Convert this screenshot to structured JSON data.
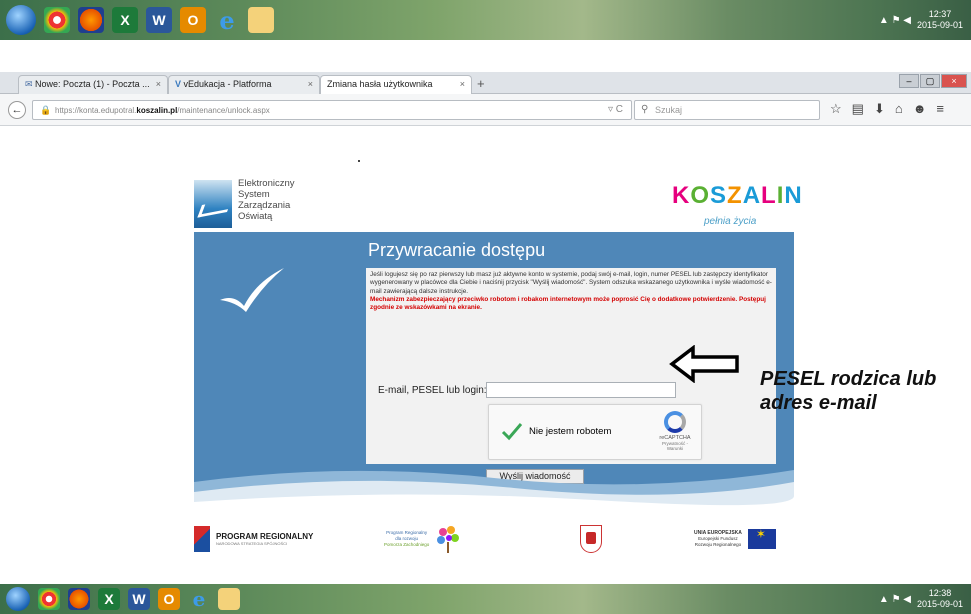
{
  "taskbar": {
    "apps": [
      {
        "icon": "windows-start-icon"
      },
      {
        "icon": "chrome-icon"
      },
      {
        "icon": "firefox-icon"
      },
      {
        "icon": "excel-icon",
        "glyph": "X"
      },
      {
        "icon": "word-icon",
        "glyph": "W"
      },
      {
        "icon": "outlook-icon",
        "glyph": "O"
      },
      {
        "icon": "ie-icon",
        "glyph": "e"
      },
      {
        "icon": "folder-icon"
      }
    ],
    "top_clock": {
      "time": "12:37",
      "date": "2015-09-01"
    },
    "bottom_clock": {
      "time": "12:38",
      "date": "2015-09-01"
    }
  },
  "browser": {
    "tabs": [
      {
        "label": "Nowe: Poczta (1) - Poczta ..."
      },
      {
        "label": "vEdukacja - Platforma"
      },
      {
        "label": "Zmiana hasła użytkownika"
      }
    ],
    "new_tab": "+",
    "url_prefix": "https://konta.edupotral.",
    "url_domain": "koszalin.pl",
    "url_path": "/maintenance/unlock.aspx",
    "search_placeholder": "Szukaj"
  },
  "page": {
    "esz_logo_lines": [
      "Elektroniczny",
      "System",
      "Zarządzania",
      "Oświatą"
    ],
    "koszalin_logo": {
      "word": "KOSZALIN",
      "tagline": "pełnia życia",
      "letter_colors": [
        "#e6007e",
        "#5ab033",
        "#1a9bd7",
        "#f39200",
        "#1a9bd7",
        "#e6007e",
        "#5ab033",
        "#1a9bd7"
      ]
    },
    "panel_title": "Przywracanie dostępu",
    "info_text": "Jeśli logujesz się po raz pierwszy lub masz już aktywne konto w systemie, podaj swój e-mail, login, numer PESEL lub zastępczy identyfikator wygenerowany w placówce dla Ciebie i naciśnij przycisk \"Wyślij wiadomość\". System odszuka wskazanego użytkownika i wyśle wiadomość e-mail zawierającą dalsze instrukcje.",
    "warning_text": "Mechanizm zabezpieczający przeciwko robotom i robakom internetowym może poprosić Cię o dodatkowe potwierdzenie. Postępuj zgodnie ze wskazówkami na ekranie.",
    "email_label": "E-mail, PESEL lub login:",
    "email_value": "",
    "recaptcha": {
      "label": "Nie jestem robotem",
      "brand": "reCAPTCHA",
      "links": "Prywatność - Warunki"
    },
    "send_button": "Wyślij wiadomość",
    "sponsors": {
      "program_regionalny": "PROGRAM REGIONALNY",
      "program_regionalny_sub": "NARODOWA STRATEGIA SPÓJNOŚCI",
      "pomorze_lines": [
        "Program Regionalny",
        "dla rozwoju",
        "Pomorza Zachodniego"
      ],
      "ue_title": "UNIA EUROPEJSKA",
      "ue_lines": [
        "Europejski Fundusz",
        "Rozwoju Regionalnego"
      ]
    }
  },
  "annotation": {
    "lines": [
      "PESEL rodzica lub",
      "adres e-mail"
    ]
  },
  "colors": {
    "panel_blue": "#4f87b8",
    "warning_red": "#d40000",
    "recaptcha_green": "#3aa757"
  }
}
